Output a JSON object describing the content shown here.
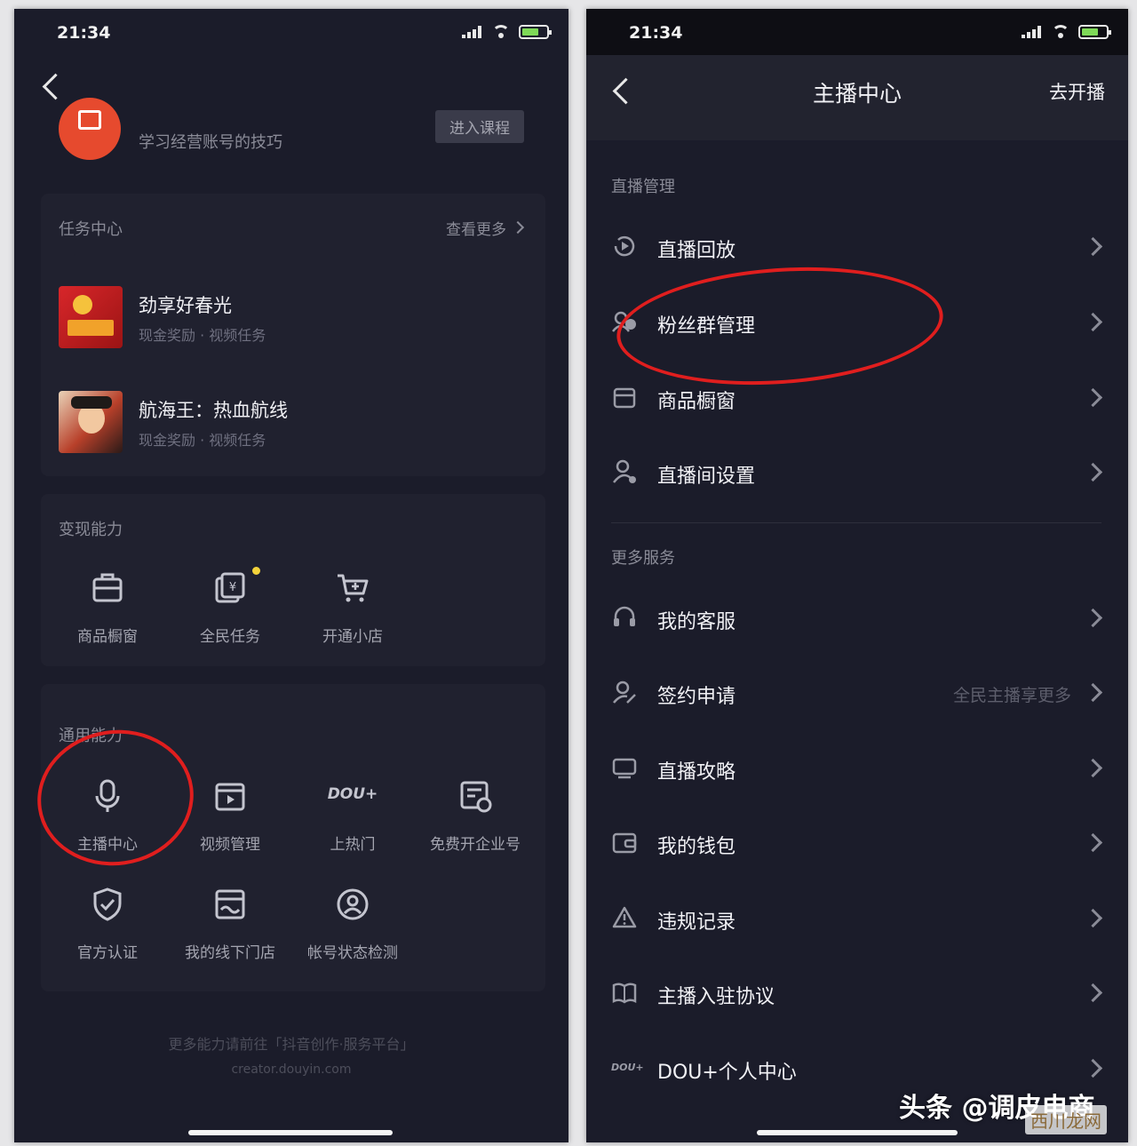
{
  "left": {
    "status": {
      "time": "21:34"
    },
    "course": {
      "subtitle": "学习经营账号的技巧",
      "button": "进入课程"
    },
    "tasks": {
      "title": "任务中心",
      "more": "查看更多",
      "items": [
        {
          "title": "劲享好春光",
          "meta": "现金奖励 · 视频任务"
        },
        {
          "title": "航海王：热血航线",
          "meta": "现金奖励 · 视频任务"
        }
      ]
    },
    "monetize": {
      "title": "变现能力",
      "items": [
        {
          "label": "商品橱窗",
          "icon": "shop-window-icon"
        },
        {
          "label": "全民任务",
          "icon": "tasks-icon"
        },
        {
          "label": "开通小店",
          "icon": "cart-icon"
        }
      ]
    },
    "general": {
      "title": "通用能力",
      "items": [
        {
          "label": "主播中心",
          "icon": "microphone-icon"
        },
        {
          "label": "视频管理",
          "icon": "video-manage-icon"
        },
        {
          "label": "上热门",
          "icon": "dou-plus-icon",
          "icon_text": "DOU+"
        },
        {
          "label": "免费开企业号",
          "icon": "enterprise-icon"
        },
        {
          "label": "官方认证",
          "icon": "shield-check-icon"
        },
        {
          "label": "我的线下门店",
          "icon": "store-icon"
        },
        {
          "label": "帐号状态检测",
          "icon": "account-check-icon"
        }
      ]
    },
    "footer": {
      "line1": "更多能力请前往「抖音创作·服务平台」",
      "line2": "creator.douyin.com"
    }
  },
  "right": {
    "status": {
      "time": "21:34"
    },
    "header": {
      "title": "主播中心",
      "action": "去开播"
    },
    "live_section": {
      "title": "直播管理",
      "items": [
        {
          "label": "直播回放",
          "icon": "replay-icon"
        },
        {
          "label": "粉丝群管理",
          "icon": "fans-group-icon"
        },
        {
          "label": "商品橱窗",
          "icon": "shop-window-icon"
        },
        {
          "label": "直播间设置",
          "icon": "room-settings-icon"
        }
      ]
    },
    "more_section": {
      "title": "更多服务",
      "items": [
        {
          "label": "我的客服",
          "icon": "headset-icon"
        },
        {
          "label": "签约申请",
          "icon": "sign-icon",
          "extra": "全民主播享更多"
        },
        {
          "label": "直播攻略",
          "icon": "guide-icon"
        },
        {
          "label": "我的钱包",
          "icon": "wallet-icon"
        },
        {
          "label": "违规记录",
          "icon": "warning-icon"
        },
        {
          "label": "主播入驻协议",
          "icon": "book-icon"
        },
        {
          "label": "DOU+个人中心",
          "icon": "dou-plus-icon",
          "icon_text": "DOU+"
        }
      ]
    }
  },
  "watermark": {
    "text": "头条 @调皮电商",
    "site": "西川龙网"
  },
  "colors": {
    "bg": "#1b1c2a",
    "card": "#20212f",
    "highlight": "#e01e1e",
    "course_icon": "#e64a2e"
  }
}
